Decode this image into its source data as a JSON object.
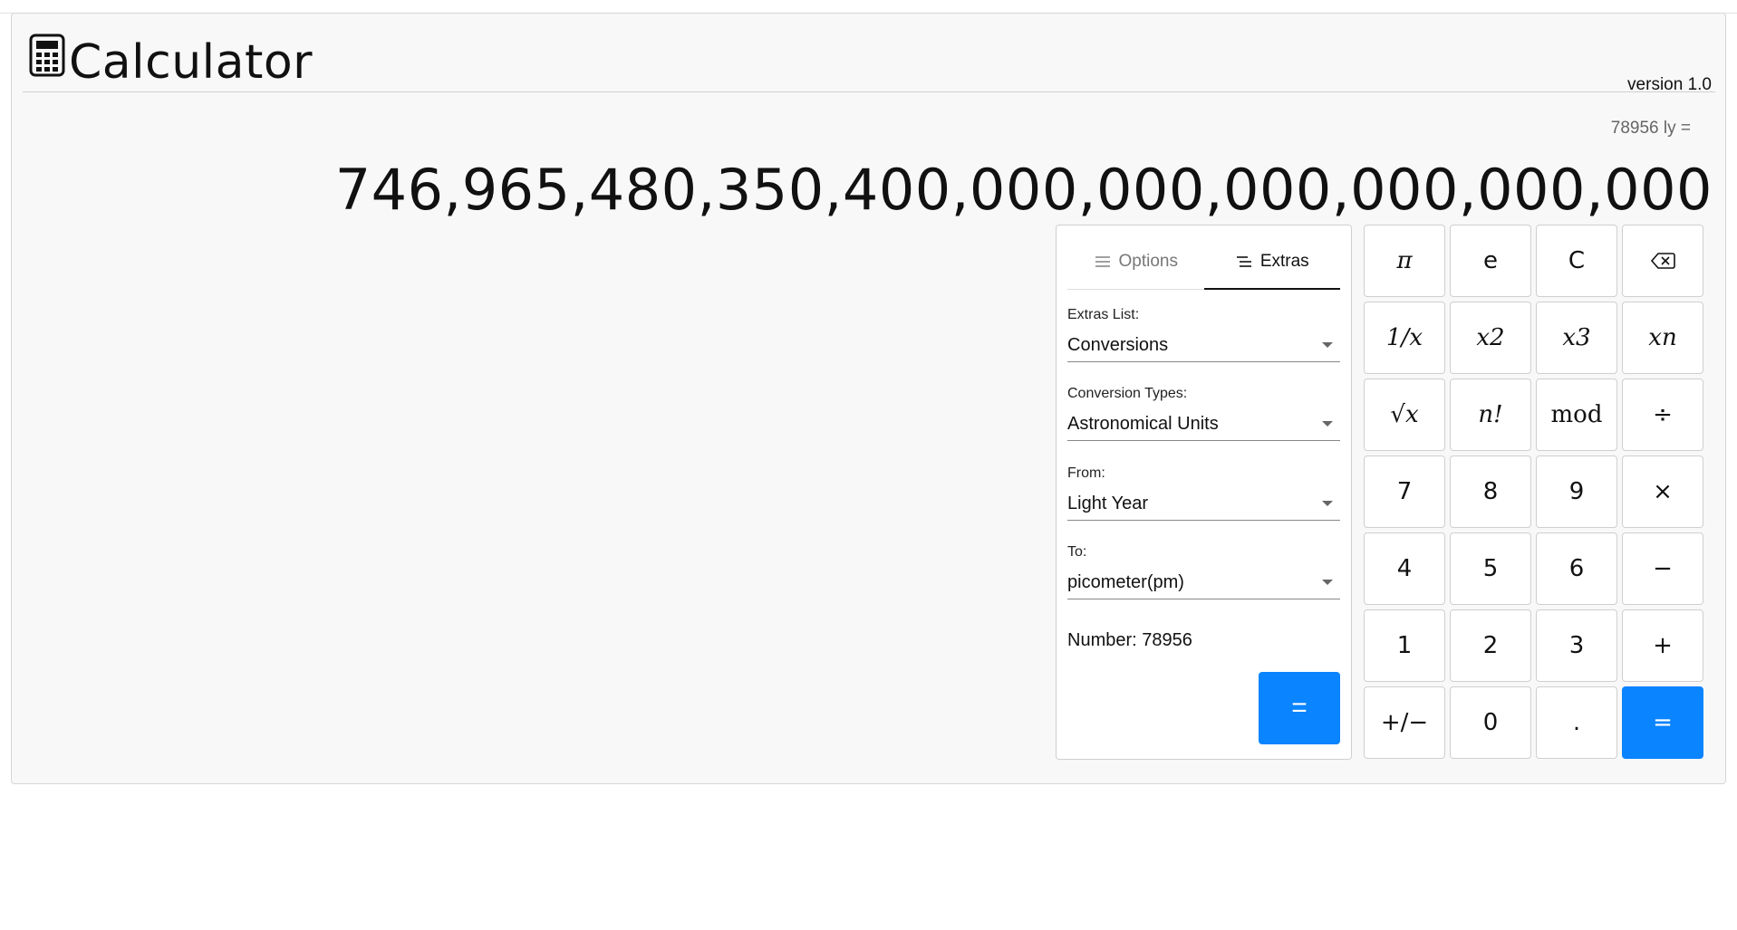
{
  "app": {
    "title": "Calculator",
    "version": "version 1.0"
  },
  "display": {
    "expression": "78956 ly =",
    "result": "746,965,480,350,400,000,000,000,000,000,000"
  },
  "panel": {
    "tabs": [
      {
        "label": "Options",
        "icon": "menu-icon",
        "active": false
      },
      {
        "label": "Extras",
        "icon": "list-indent-icon",
        "active": true
      }
    ],
    "fields": [
      {
        "label": "Extras List:",
        "value": "Conversions"
      },
      {
        "label": "Conversion Types:",
        "value": "Astronomical Units"
      },
      {
        "label": "From:",
        "value": "Light Year"
      },
      {
        "label": "To:",
        "value": "picometer(pm)"
      }
    ],
    "number_text": "Number: 78956",
    "equals_label": "="
  },
  "keypad": {
    "rows": [
      [
        "π",
        "e",
        "C",
        "⌫"
      ],
      [
        "1/x",
        "x2",
        "x3",
        "xn"
      ],
      [
        "√x",
        "n!",
        "mod",
        "÷"
      ],
      [
        "7",
        "8",
        "9",
        "×"
      ],
      [
        "4",
        "5",
        "6",
        "−"
      ],
      [
        "1",
        "2",
        "3",
        "+"
      ],
      [
        "+/−",
        "0",
        ".",
        "="
      ]
    ]
  },
  "colors": {
    "accent": "#0a84ff",
    "panel_bg": "#f8f8f8",
    "border": "#cfcfcf"
  }
}
